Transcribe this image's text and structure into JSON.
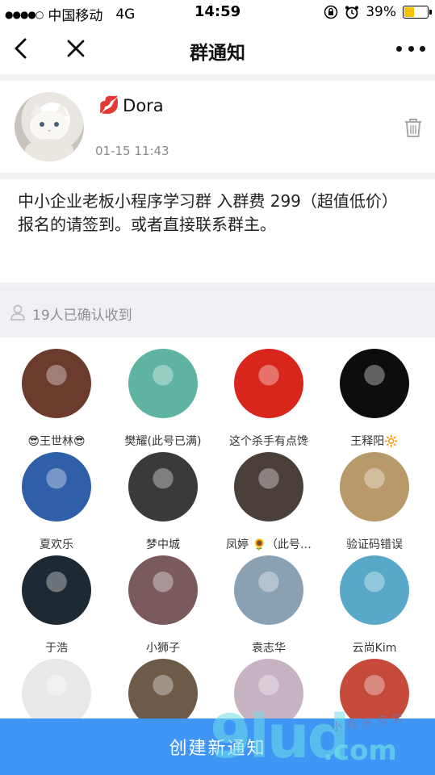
{
  "status_bar": {
    "signal_dots": "●●●●○",
    "carrier": "中国移动",
    "network": "4G",
    "time": "14:59",
    "battery_percent": "39%",
    "battery_level": 0.39,
    "battery_color": "#f4c300"
  },
  "nav": {
    "title": "群通知",
    "back_icon": "chevron-left-icon",
    "close_icon": "close-icon",
    "more_icon": "more-dots-icon"
  },
  "author": {
    "name": "Dora",
    "name_emoji": "💋",
    "time": "01-15 11:43",
    "delete_icon": "trash-icon"
  },
  "message": {
    "text": "中小企业老板小程序学习群 入群费 299（超值低价）\n报名的请签到。或者直接联系群主。"
  },
  "confirmed": {
    "text": "19人已确认收到",
    "icon": "user-icon"
  },
  "members": [
    {
      "name": "😎王世林😎",
      "color": "#6b3b2e"
    },
    {
      "name": "樊耀(此号已满)",
      "color": "#5fb3a1"
    },
    {
      "name": "这个杀手有点馋",
      "color": "#d9261c"
    },
    {
      "name": "王释阳🔆",
      "color": "#0d0d0d"
    },
    {
      "name": "夏欢乐",
      "color": "#2f5fa8"
    },
    {
      "name": "梦中城",
      "color": "#3a3a3a"
    },
    {
      "name": "凤婷 🌻（此号…",
      "color": "#4b3f3a"
    },
    {
      "name": "验证码错误",
      "color": "#b89a6a"
    },
    {
      "name": "于浩",
      "color": "#1e2a33"
    },
    {
      "name": "小狮子",
      "color": "#7b5a5e"
    },
    {
      "name": "袁志华",
      "color": "#8aa1b3"
    },
    {
      "name": "云尚Kim",
      "color": "#58a9c9"
    },
    {
      "name": "",
      "color": "#e8e8e8"
    },
    {
      "name": "",
      "color": "#6d5a48"
    },
    {
      "name": "",
      "color": "#c7b2c2"
    },
    {
      "name": "",
      "color": "#c54a3a"
    }
  ],
  "create_button": {
    "label": "创建新通知",
    "color": "#3f96f5"
  },
  "watermark": {
    "big": "9lud",
    "domain": ".com",
    "chinese": "小程序商店"
  }
}
